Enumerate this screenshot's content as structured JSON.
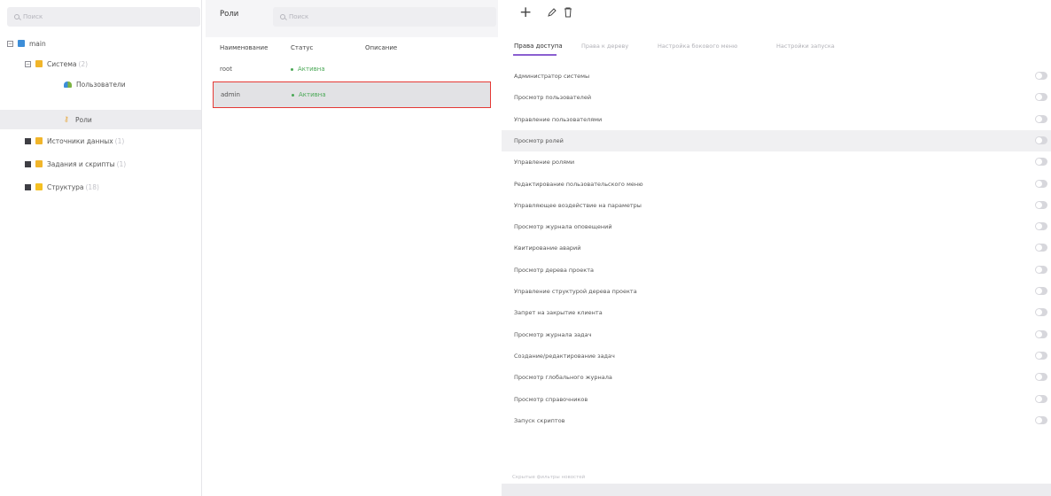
{
  "tree": {
    "search_placeholder": "Поиск",
    "items": [
      {
        "label": "main",
        "count": ""
      },
      {
        "label": "Система",
        "count": "(2)"
      },
      {
        "label": "Пользователи",
        "count": ""
      },
      {
        "label": "Роли",
        "count": ""
      },
      {
        "label": "Источники данных",
        "count": "(1)"
      },
      {
        "label": "Задания и скрипты",
        "count": "(1)"
      },
      {
        "label": "Структура",
        "count": "(18)"
      }
    ]
  },
  "roles": {
    "title": "Роли",
    "search_placeholder": "Поиск",
    "columns": {
      "name": "Наименование",
      "status": "Статус",
      "description": "Описание"
    },
    "rows": [
      {
        "name": "root",
        "status": "Активна",
        "description": ""
      },
      {
        "name": "admin",
        "status": "Активна",
        "description": ""
      }
    ]
  },
  "toolbar": {
    "add_icon": "plus-icon",
    "edit_icon": "pencil-icon",
    "delete_icon": "trash-icon"
  },
  "permissions": {
    "tabs": [
      "Права доступа",
      "Права к дереву",
      "Настройка бокового меню",
      "Настройки запуска"
    ],
    "items": [
      {
        "label": "Администратор системы",
        "enabled": false
      },
      {
        "label": "Просмотр пользователей",
        "enabled": false
      },
      {
        "label": "Управление пользователями",
        "enabled": false
      },
      {
        "label": "Просмотр ролей",
        "enabled": false
      },
      {
        "label": "Управление ролями",
        "enabled": false
      },
      {
        "label": "Редактирование пользовательского меню",
        "enabled": false
      },
      {
        "label": "Управляющее воздействие на параметры",
        "enabled": false
      },
      {
        "label": "Просмотр журнала оповещений",
        "enabled": false
      },
      {
        "label": "Квитирование аварий",
        "enabled": false
      },
      {
        "label": "Просмотр дерева проекта",
        "enabled": false
      },
      {
        "label": "Управление структурой дерева проекта",
        "enabled": false
      },
      {
        "label": "Запрет на закрытие клиента",
        "enabled": false
      },
      {
        "label": "Просмотр журнала задач",
        "enabled": false
      },
      {
        "label": "Создание/редактирование задач",
        "enabled": false
      },
      {
        "label": "Просмотр глобального журнала",
        "enabled": false
      },
      {
        "label": "Просмотр справочников",
        "enabled": false
      },
      {
        "label": "Запуск скриптов",
        "enabled": false
      }
    ],
    "footer_label": "Скрытые фильтры новостей"
  }
}
